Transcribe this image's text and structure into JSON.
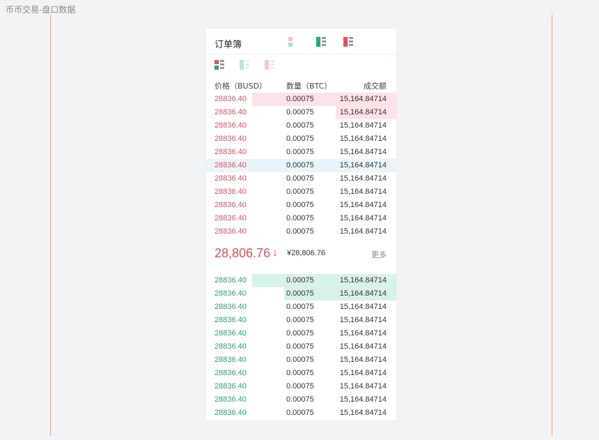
{
  "page_caption": "币币交易-盘口数据",
  "orderbook": {
    "title": "订单簿",
    "columns": {
      "price": "价格（BUSD）",
      "qty": "数量（BTC）",
      "total": "成交额"
    },
    "colors": {
      "sell": "#e8515c",
      "buy": "#23a878",
      "sell_depth": "#fde3e6",
      "buy_depth": "#d8f2e7",
      "highlight": "#eaf3f7"
    },
    "view_icons_top": [
      {
        "name": "view-sell-only-icon",
        "state": "dimmed"
      },
      {
        "name": "view-buy-only-icon",
        "state": "active"
      },
      {
        "name": "view-sell-only-icon-alt",
        "state": "active"
      }
    ],
    "view_icons_sub": [
      {
        "name": "view-both-icon",
        "state": "active"
      },
      {
        "name": "view-buy-icon",
        "state": "dimmed"
      },
      {
        "name": "view-sell-icon",
        "state": "dimmed"
      }
    ],
    "asks": [
      {
        "price": "28836.40",
        "qty": "0.00075",
        "total": "15,164.84714",
        "depth": 0.76
      },
      {
        "price": "28836.40",
        "qty": "0.00075",
        "total": "15,164.84714",
        "depth": 0.32
      },
      {
        "price": "28836.40",
        "qty": "0.00075",
        "total": "15,164.84714",
        "depth": 0
      },
      {
        "price": "28836.40",
        "qty": "0.00075",
        "total": "15,164.84714",
        "depth": 0
      },
      {
        "price": "28836.40",
        "qty": "0.00075",
        "total": "15,164.84714",
        "depth": 0
      },
      {
        "price": "28836.40",
        "qty": "0.00075",
        "total": "15,164.84714",
        "depth": 0,
        "highlight": true
      },
      {
        "price": "28836.40",
        "qty": "0.00075",
        "total": "15,164.84714",
        "depth": 0
      },
      {
        "price": "28836.40",
        "qty": "0.00075",
        "total": "15,164.84714",
        "depth": 0
      },
      {
        "price": "28836.40",
        "qty": "0.00075",
        "total": "15,164.84714",
        "depth": 0
      },
      {
        "price": "28836.40",
        "qty": "0.00075",
        "total": "15,164.84714",
        "depth": 0
      },
      {
        "price": "28836.40",
        "qty": "0.00075",
        "total": "15,164.84714",
        "depth": 0
      }
    ],
    "ticker": {
      "last_price": "28,806.76",
      "direction_icon": "arrow-down-icon",
      "arrow": "↓",
      "cny_price": "¥28,806.76",
      "more": "更多"
    },
    "bids": [
      {
        "price": "28836.40",
        "qty": "0.00075",
        "total": "15,164.84714",
        "depth": 0.76
      },
      {
        "price": "28836.40",
        "qty": "0.00075",
        "total": "15,164.84714",
        "depth": 0.59
      },
      {
        "price": "28836.40",
        "qty": "0.00075",
        "total": "15,164.84714",
        "depth": 0
      },
      {
        "price": "28836.40",
        "qty": "0.00075",
        "total": "15,164.84714",
        "depth": 0
      },
      {
        "price": "28836.40",
        "qty": "0.00075",
        "total": "15,164.84714",
        "depth": 0
      },
      {
        "price": "28836.40",
        "qty": "0.00075",
        "total": "15,164.84714",
        "depth": 0
      },
      {
        "price": "28836.40",
        "qty": "0.00075",
        "total": "15,164.84714",
        "depth": 0
      },
      {
        "price": "28836.40",
        "qty": "0.00075",
        "total": "15,164.84714",
        "depth": 0
      },
      {
        "price": "28836.40",
        "qty": "0.00075",
        "total": "15,164.84714",
        "depth": 0
      },
      {
        "price": "28836.40",
        "qty": "0.00075",
        "total": "15,164.84714",
        "depth": 0
      },
      {
        "price": "28836.40",
        "qty": "0.00075",
        "total": "15,164.84714",
        "depth": 0
      }
    ]
  }
}
